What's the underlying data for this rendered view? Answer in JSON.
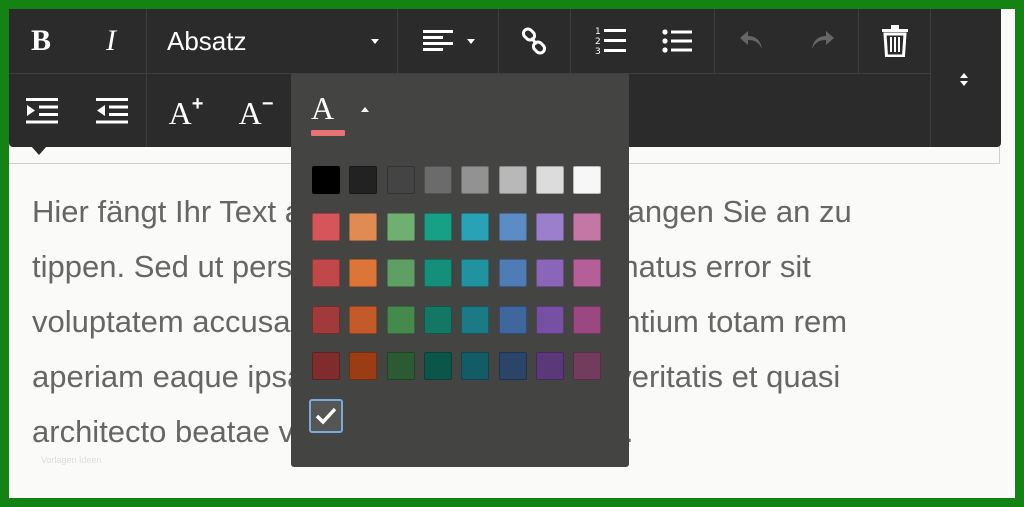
{
  "toolbar": {
    "bold_label": "B",
    "italic_label": "I",
    "paragraph_select": "Absatz",
    "font_grow_label": "A",
    "font_grow_sup": "+",
    "font_shrink_label": "A",
    "font_shrink_sup": "−",
    "text_color_label": "A",
    "text_color_underline": "#e57373",
    "icons": [
      "bold-icon",
      "italic-icon",
      "align-left-icon",
      "link-icon",
      "ordered-list-icon",
      "unordered-list-icon",
      "undo-icon",
      "redo-icon",
      "trash-icon",
      "collapse-icon",
      "indent-icon",
      "outdent-icon",
      "font-grow-icon",
      "font-shrink-icon",
      "text-color-icon"
    ]
  },
  "editor": {
    "lines": [
      "Hier fängt Ihr Text an. Klicken Sie hier und fangen Sie an zu",
      "tippen. Sed ut perspiciatis unde omnis iste natus error sit",
      "voluptatem accusantium doloremque laudantium totam rem",
      "aperiam eaque ipsa quae ab illo inventore veritatis et quasi",
      "architecto beatae vitae dicta sunt explicabo."
    ],
    "watermark": "Vorlagen Ideen"
  },
  "color_palette": {
    "rows": [
      [
        "#000000",
        "#222222",
        "#444444",
        "#6b6b6b",
        "#929292",
        "#b8b8b8",
        "#dcdcdc",
        "#f7f7f7"
      ],
      [
        "#d5555a",
        "#e08a54",
        "#6faf6f",
        "#16a085",
        "#2aa2b5",
        "#5b8cc4",
        "#9b7fcc",
        "#c476a4"
      ],
      [
        "#c04848",
        "#dd7438",
        "#5e9f63",
        "#138f7a",
        "#21929f",
        "#4e7db5",
        "#8a66b9",
        "#b55e97"
      ],
      [
        "#a13a3a",
        "#c45a28",
        "#448a4b",
        "#137763",
        "#1b7a86",
        "#3f679e",
        "#7550a3",
        "#9b4781"
      ],
      [
        "#802c2c",
        "#9c3c14",
        "#2c5a32",
        "#0c5649",
        "#115c66",
        "#2b4569",
        "#5a387a",
        "#733c5c"
      ]
    ]
  }
}
